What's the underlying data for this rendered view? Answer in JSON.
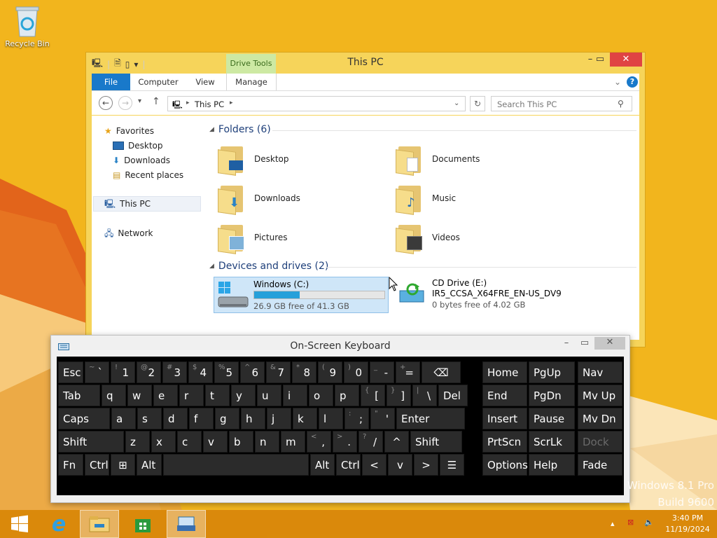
{
  "desktop": {
    "recycle_bin_label": "Recycle Bin",
    "watermark_line1": "Windows 8.1 Pro",
    "watermark_line2": "Build 9600"
  },
  "explorer": {
    "title": "This PC",
    "contextual_tab_group": "Drive Tools",
    "ribbon_tabs": [
      "File",
      "Computer",
      "View",
      "Manage"
    ],
    "address_path": "This PC",
    "search_placeholder": "Search This PC",
    "nav_pane": {
      "favorites": "Favorites",
      "favorites_items": [
        "Desktop",
        "Downloads",
        "Recent places"
      ],
      "this_pc": "This PC",
      "network": "Network"
    },
    "folders_header": "Folders (6)",
    "folders": [
      "Desktop",
      "Documents",
      "Downloads",
      "Music",
      "Pictures",
      "Videos"
    ],
    "devices_header": "Devices and drives (2)",
    "drives": [
      {
        "name": "Windows (C:)",
        "free_text": "26.9 GB free of 41.3 GB",
        "used_fraction": 0.35
      },
      {
        "name": "CD Drive (E:)",
        "label": "IR5_CCSA_X64FRE_EN-US_DV9",
        "free_text": "0 bytes free of 4.02 GB"
      }
    ],
    "accent_color": "#1979ca"
  },
  "osk": {
    "title": "On-Screen Keyboard",
    "rows": [
      [
        {
          "l": "Esc"
        },
        {
          "s": "~",
          "m": "`"
        },
        {
          "s": "!",
          "m": "1"
        },
        {
          "s": "@",
          "m": "2"
        },
        {
          "s": "#",
          "m": "3"
        },
        {
          "s": "$",
          "m": "4"
        },
        {
          "s": "%",
          "m": "5"
        },
        {
          "s": "^",
          "m": "6"
        },
        {
          "s": "&",
          "m": "7"
        },
        {
          "s": "*",
          "m": "8"
        },
        {
          "s": "(",
          "m": "9"
        },
        {
          "s": ")",
          "m": "0"
        },
        {
          "s": "_",
          "m": "-"
        },
        {
          "s": "+",
          "m": "="
        },
        {
          "l": "⌫"
        }
      ],
      [
        {
          "l": "Tab"
        },
        {
          "l": "q"
        },
        {
          "l": "w"
        },
        {
          "l": "e"
        },
        {
          "l": "r"
        },
        {
          "l": "t"
        },
        {
          "l": "y"
        },
        {
          "l": "u"
        },
        {
          "l": "i"
        },
        {
          "l": "o"
        },
        {
          "l": "p"
        },
        {
          "s": "{",
          "m": "["
        },
        {
          "s": "}",
          "m": "]"
        },
        {
          "s": "|",
          "m": "\\"
        },
        {
          "l": "Del"
        }
      ],
      [
        {
          "l": "Caps"
        },
        {
          "l": "a"
        },
        {
          "l": "s"
        },
        {
          "l": "d"
        },
        {
          "l": "f"
        },
        {
          "l": "g"
        },
        {
          "l": "h"
        },
        {
          "l": "j"
        },
        {
          "l": "k"
        },
        {
          "l": "l"
        },
        {
          "s": ":",
          "m": ";"
        },
        {
          "s": "\"",
          "m": "'"
        },
        {
          "l": "Enter"
        }
      ],
      [
        {
          "l": "Shift"
        },
        {
          "l": "z"
        },
        {
          "l": "x"
        },
        {
          "l": "c"
        },
        {
          "l": "v"
        },
        {
          "l": "b"
        },
        {
          "l": "n"
        },
        {
          "l": "m"
        },
        {
          "s": "<",
          "m": ","
        },
        {
          "s": ">",
          "m": "."
        },
        {
          "s": "?",
          "m": "/"
        },
        {
          "l": "^"
        },
        {
          "l": "Shift"
        }
      ],
      [
        {
          "l": "Fn"
        },
        {
          "l": "Ctrl"
        },
        {
          "l": "⊞"
        },
        {
          "l": "Alt"
        },
        {
          "l": ""
        },
        {
          "l": "Alt"
        },
        {
          "l": "Ctrl"
        },
        {
          "l": "<"
        },
        {
          "l": "v"
        },
        {
          "l": ">"
        },
        {
          "l": "☰"
        }
      ]
    ],
    "nav_keys": [
      [
        "Home",
        "PgUp",
        "Nav"
      ],
      [
        "End",
        "PgDn",
        "Mv Up"
      ],
      [
        "Insert",
        "Pause",
        "Mv Dn"
      ],
      [
        "PrtScn",
        "ScrLk",
        "Dock"
      ],
      [
        "Options",
        "Help",
        "Fade"
      ]
    ]
  },
  "taskbar": {
    "time": "3:40 PM",
    "date": "11/19/2024",
    "color": "#d8860a"
  }
}
